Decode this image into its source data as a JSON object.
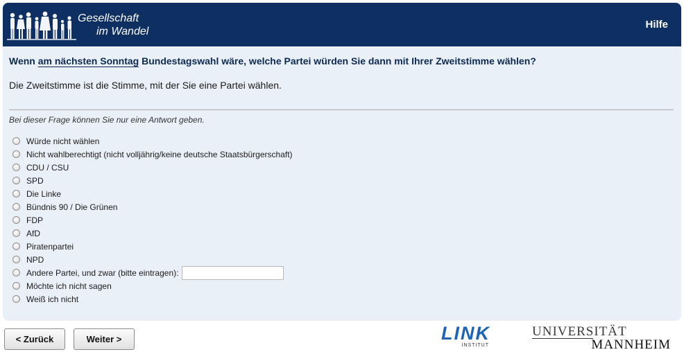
{
  "header": {
    "logo_line1": "Gesellschaft",
    "logo_line2": "im Wandel",
    "help_label": "Hilfe",
    "bg_color": "#0d2f62"
  },
  "question": {
    "pre": "Wenn ",
    "emphasis": "am nächsten Sonntag",
    "post": " Bundestagswahl wäre, welche Partei würden Sie dann mit Ihrer Zweitstimme wählen?"
  },
  "explanation": "Die Zweitstimme ist die Stimme, mit der Sie eine Partei wählen.",
  "instruction": "Bei dieser Frage können Sie nur eine Antwort geben.",
  "options": [
    "Würde nicht wählen",
    "Nicht wahlberechtigt (nicht volljährig/keine deutsche Staatsbürgerschaft)",
    "CDU / CSU",
    "SPD",
    "Die Linke",
    "Bündnis 90 / Die Grünen",
    "FDP",
    "AfD",
    "Piratenpartei",
    "NPD",
    "Andere Partei, und zwar (bitte eintragen):",
    "Möchte ich nicht sagen",
    "Weiß ich nicht"
  ],
  "other_input": {
    "value": ""
  },
  "nav": {
    "back_label": "< Zurück",
    "next_label": "Weiter >"
  },
  "footer": {
    "link_logo": "LINK",
    "link_sub": "INSTITUT",
    "uni_line1": "UNIVERSITÄT",
    "uni_line2": "MANNHEIM"
  }
}
